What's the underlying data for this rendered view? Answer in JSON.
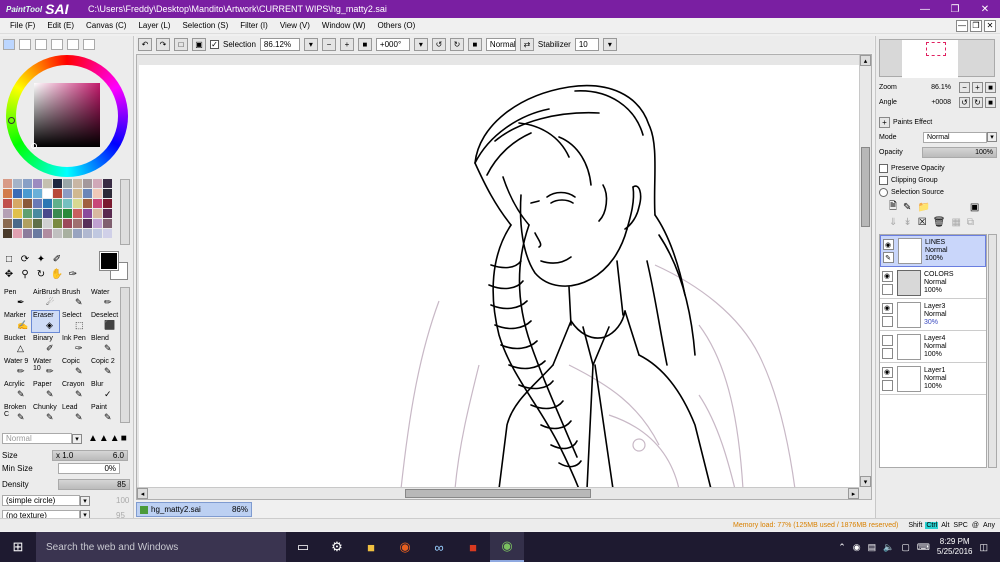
{
  "app": {
    "logo_prefix": "PaintTool",
    "logo_name": "SAI",
    "title": "C:\\Users\\Freddy\\Desktop\\Mandito\\Artwork\\CURRENT WIPS\\hg_matty2.sai",
    "accent": "#7a1fa2"
  },
  "menu": [
    "File (F)",
    "Edit (E)",
    "Canvas (C)",
    "Layer (L)",
    "Selection (S)",
    "Filter (I)",
    "View (V)",
    "Window (W)",
    "Others (O)"
  ],
  "canvas_toolbar": {
    "selection_label": "Selection",
    "selection_checked": true,
    "zoom": "86.12%",
    "rotation": "+000°",
    "blend": "Normal",
    "stabilizer_label": "Stabilizer",
    "stabilizer_value": "10"
  },
  "swatch_colors": [
    "#d89a86",
    "#a4b3c8",
    "#88a0c6",
    "#9c8cc0",
    "#c4c0b0",
    "#1e2840",
    "#9aa6a8",
    "#c8b6a4",
    "#a4989c",
    "#d0a8b8",
    "#3a2c44",
    "#d27c4c",
    "#3c6cb6",
    "#4a9ad0",
    "#6ab0d8",
    "#ffffff",
    "#b84a3a",
    "#8c9cc4",
    "#d0b890",
    "#6c86b8",
    "#f0c8b8",
    "#2e2a38",
    "#c0504c",
    "#d6a866",
    "#8a5a3a",
    "#6a7ab6",
    "#2c78b4",
    "#60b08c",
    "#74c0c0",
    "#d8d890",
    "#a06040",
    "#c84878",
    "#7a1a30",
    "#b4a0b4",
    "#e0c04c",
    "#60a070",
    "#4a8aa0",
    "#4a4a8c",
    "#3a8a50",
    "#2a8a3a",
    "#c86060",
    "#8a4a9c",
    "#d8b8a0",
    "#5a2a50",
    "#8a6a50",
    "#4a6a8a",
    "#b0a060",
    "#60704a",
    "#d0d0d0",
    "#7a8a40",
    "#9c4a5a",
    "#a07070",
    "#58305a",
    "#c0a0d0",
    "#806070",
    "#4a3a2a",
    "#e0a0b0",
    "#8c7c9c",
    "#6a7aa0",
    "#b08ca0",
    "#c0c0c0",
    "#a8b0a0",
    "#98a4c0",
    "#b0b8d0",
    "#c0c8e0",
    "#d0d0e8"
  ],
  "brushes": [
    {
      "name": "Pen",
      "icon": "pen-icon"
    },
    {
      "name": "AirBrush",
      "icon": "airbrush-icon"
    },
    {
      "name": "Brush",
      "icon": "brush-icon"
    },
    {
      "name": "Water",
      "icon": "water-icon"
    },
    {
      "name": "Marker",
      "icon": "marker-icon"
    },
    {
      "name": "Eraser",
      "icon": "eraser-icon",
      "selected": true
    },
    {
      "name": "Select",
      "icon": "select-icon"
    },
    {
      "name": "Deselect",
      "icon": "deselect-icon"
    },
    {
      "name": "Bucket",
      "icon": "bucket-icon"
    },
    {
      "name": "Binary",
      "icon": "binary-icon"
    },
    {
      "name": "Ink Pen",
      "icon": "inkpen-icon"
    },
    {
      "name": "Blend",
      "icon": "blend-icon"
    },
    {
      "name": "Water 9",
      "icon": "water-icon"
    },
    {
      "name": "Water 10",
      "icon": "water-icon"
    },
    {
      "name": "Copic",
      "icon": "copic-icon"
    },
    {
      "name": "Copic 2",
      "icon": "copic-icon"
    },
    {
      "name": "Acrylic",
      "icon": "acrylic-icon"
    },
    {
      "name": "Paper",
      "icon": "paper-icon"
    },
    {
      "name": "Crayon",
      "icon": "crayon-icon"
    },
    {
      "name": "Blur",
      "icon": "blur-icon"
    },
    {
      "name": "Broken C",
      "icon": "brush-icon"
    },
    {
      "name": "Chunky",
      "icon": "brush-icon"
    },
    {
      "name": "Lead",
      "icon": "brush-icon"
    },
    {
      "name": "Paint",
      "icon": "brush-icon"
    }
  ],
  "brush_settings": {
    "blend_mode": "Normal",
    "size_label": "Size",
    "size_multiplier": "x 1.0",
    "size_value": "6.0",
    "min_size_label": "Min Size",
    "min_size_value": "0%",
    "density_label": "Density",
    "density_value": "85",
    "shape": "(simple circle)",
    "shape_value": "100",
    "texture": "(no texture)",
    "texture_value": "95"
  },
  "navigator": {
    "zoom_label": "Zoom",
    "zoom_value": "86.1%",
    "angle_label": "Angle",
    "angle_value": "+0008"
  },
  "layer_props": {
    "paints_effect_label": "Paints Effect",
    "mode_label": "Mode",
    "mode_value": "Normal",
    "opacity_label": "Opacity",
    "opacity_value": "100%",
    "preserve_opacity": "Preserve Opacity",
    "clipping_group": "Clipping Group",
    "selection_source": "Selection Source"
  },
  "layers": [
    {
      "name": "LINES",
      "mode": "Normal",
      "opacity": "100%",
      "visible": true,
      "selected": true
    },
    {
      "name": "COLORS",
      "mode": "Normal",
      "opacity": "100%",
      "visible": true,
      "folder": true
    },
    {
      "name": "Layer3",
      "mode": "Normal",
      "opacity": "30%",
      "visible": true
    },
    {
      "name": "Layer4",
      "mode": "Normal",
      "opacity": "100%",
      "visible": false
    },
    {
      "name": "Layer1",
      "mode": "Normal",
      "opacity": "100%",
      "visible": true
    }
  ],
  "document_tab": {
    "name": "hg_matty2.sai",
    "zoom": "86%"
  },
  "status": {
    "memory": "Memory load: 77% (125MB used / 1876MB reserved)",
    "keys": [
      "Shift",
      "Ctrl",
      "Alt",
      "SPC",
      "@",
      "Any"
    ],
    "active_key": "Ctrl"
  },
  "taskbar": {
    "search_placeholder": "Search the web and Windows",
    "time": "8:29 PM",
    "date": "5/25/2016"
  }
}
